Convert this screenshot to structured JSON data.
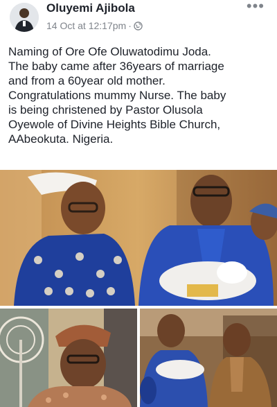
{
  "post": {
    "author": "Oluyemi Ajibola",
    "timestamp": "14 Oct at 12:17pm",
    "audience_icon": "globe-icon",
    "more_label": "•••",
    "lines": [
      "Naming of Ore Ofe Oluwatodimu Joda.",
      "The baby came after 36years of marriage",
      "and from a 60year old mother.",
      "Congratulations mummy Nurse. The baby",
      "is being christened by Pastor Olusola",
      "Oyewole of Divine Heights Bible Church,",
      "AAbeokuta. Nigeria."
    ]
  },
  "colors": {
    "text": "#1d2129",
    "meta": "#7f848b",
    "photo_bg": "#b98a4e"
  }
}
